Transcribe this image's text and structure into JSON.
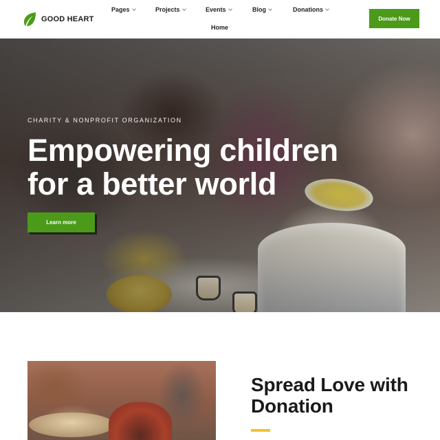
{
  "header": {
    "logo_text": "GOOD HEART",
    "logo_icon": "leaf-icon",
    "nav": [
      {
        "label": "Pages",
        "has_dropdown": true
      },
      {
        "label": "Projects",
        "has_dropdown": true
      },
      {
        "label": "Events",
        "has_dropdown": true
      },
      {
        "label": "Blog",
        "has_dropdown": true
      },
      {
        "label": "Donations",
        "has_dropdown": true
      }
    ],
    "home_label": "Home",
    "donate_label": "Donate Now"
  },
  "hero": {
    "tagline": "CHARITY & NONPROFIT ORGANIZATION",
    "title_line1": "Empowering children",
    "title_line2": "for a better world",
    "cta_label": "Learn more"
  },
  "section": {
    "title_line1": "Spread Love with",
    "title_line2": "Donation"
  },
  "colors": {
    "accent_green": "#4b9a1a",
    "accent_yellow": "#f2c230",
    "text_dark": "#1a1a1a"
  }
}
